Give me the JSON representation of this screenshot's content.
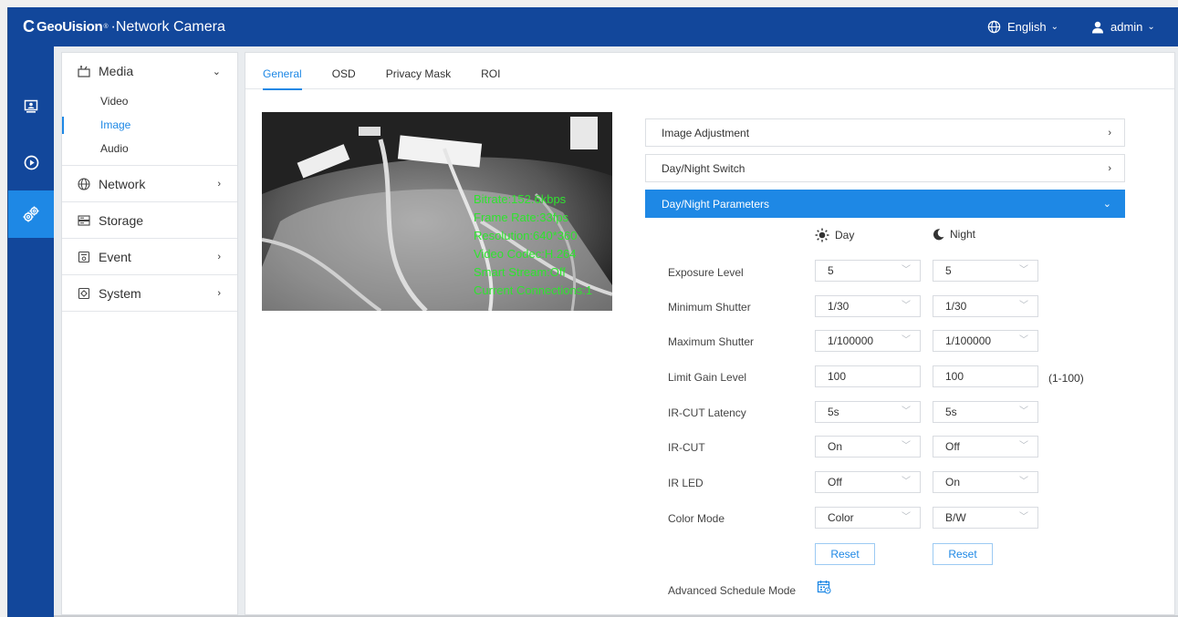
{
  "header": {
    "logo_mark": "C",
    "brand": "GeoUision",
    "trademark": "®",
    "product": "·Network Camera",
    "language": "English",
    "user": "admin"
  },
  "rail": [
    {
      "name": "live-view",
      "icon": "monitor-icon"
    },
    {
      "name": "playback",
      "icon": "play-circle-icon"
    },
    {
      "name": "settings",
      "icon": "gears-icon",
      "active": true
    }
  ],
  "menu": {
    "media": {
      "label": "Media",
      "icon": "media-icon"
    },
    "media_items": [
      "Video",
      "Image",
      "Audio"
    ],
    "network": {
      "label": "Network",
      "icon": "globe-icon"
    },
    "storage": {
      "label": "Storage",
      "icon": "storage-icon"
    },
    "event": {
      "label": "Event",
      "icon": "event-icon"
    },
    "system": {
      "label": "System",
      "icon": "system-icon"
    }
  },
  "tabs": [
    "General",
    "OSD",
    "Privacy Mask",
    "ROI"
  ],
  "video_osd": [
    "Bitrate:152.6kbps",
    "Frame Rate:33fps",
    "Resolution:640*360",
    "Video Codec:H.264",
    "Smart Stream:Off",
    "Current Connections:1"
  ],
  "sections": {
    "image_adjustment": "Image Adjustment",
    "day_night_switch": "Day/Night Switch",
    "day_night_parameters": "Day/Night Parameters"
  },
  "columns": {
    "day": "Day",
    "night": "Night"
  },
  "params": {
    "exposure_level": {
      "label": "Exposure Level",
      "day": "5",
      "night": "5"
    },
    "minimum_shutter": {
      "label": "Minimum Shutter",
      "day": "1/30",
      "night": "1/30"
    },
    "maximum_shutter": {
      "label": "Maximum Shutter",
      "day": "1/100000",
      "night": "1/100000"
    },
    "limit_gain_level": {
      "label": "Limit Gain Level",
      "day": "100",
      "night": "100",
      "range": "(1-100)"
    },
    "ir_cut_latency": {
      "label": "IR-CUT Latency",
      "day": "5s",
      "night": "5s"
    },
    "ir_cut": {
      "label": "IR-CUT",
      "day": "On",
      "night": "Off"
    },
    "ir_led": {
      "label": "IR LED",
      "day": "Off",
      "night": "On"
    },
    "color_mode": {
      "label": "Color Mode",
      "day": "Color",
      "night": "B/W"
    }
  },
  "reset_label": "Reset",
  "advanced_schedule": "Advanced Schedule Mode",
  "colors": {
    "header": "#12479b",
    "accent": "#1e88e5",
    "osd_text": "#2fe32f"
  }
}
